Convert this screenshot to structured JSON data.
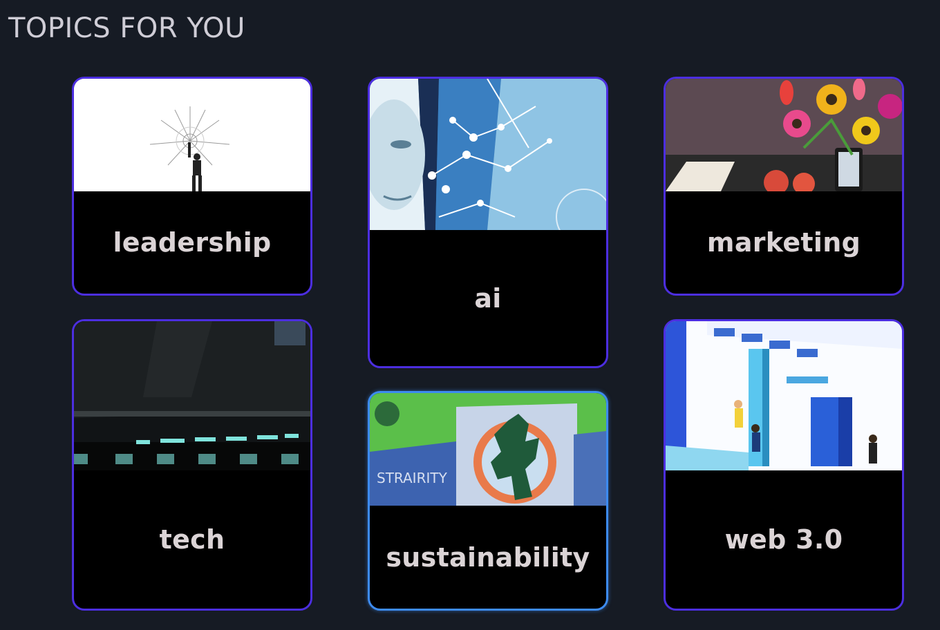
{
  "page": {
    "title": "TOPICS FOR YOU"
  },
  "topics": [
    {
      "label": "leadership",
      "image": "leadership-illustration"
    },
    {
      "label": "ai",
      "image": "ai-face-network-illustration"
    },
    {
      "label": "marketing",
      "image": "marketing-flowers-illustration"
    },
    {
      "label": "tech",
      "image": "tech-device-illustration"
    },
    {
      "label": "sustainability",
      "image": "sustainability-figure-illustration",
      "selected": true
    },
    {
      "label": "web 3.0",
      "image": "web3-isometric-illustration"
    }
  ],
  "colors": {
    "background": "#161b24",
    "card_border": "#4c2ee0",
    "card_border_selected": "#3d8bf0",
    "card_fill": "#000000",
    "label_text": "#dbd4d6"
  }
}
